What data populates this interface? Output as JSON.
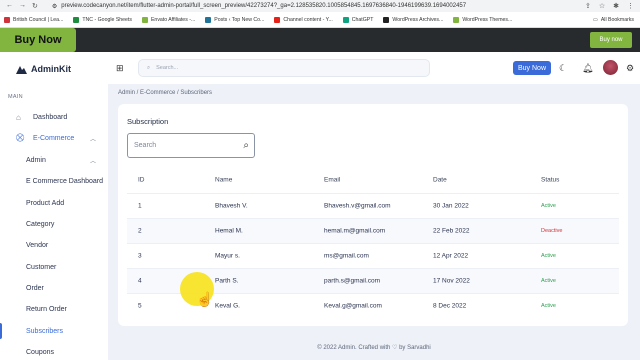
{
  "browser": {
    "url": "preview.codecanyon.net/item/flutter-admin-portal/full_screen_preview/42273274?_ga=2.128535820.1005854845.1697636840-1946199639.1694002457",
    "bookmarks": [
      {
        "label": "British Council | Lea...",
        "color": "#d0333a"
      },
      {
        "label": "TNC - Google Sheets",
        "color": "#1e8e3e"
      },
      {
        "label": "Envato Affiliates -...",
        "color": "#82b440"
      },
      {
        "label": "Posts ‹ Top New Co...",
        "color": "#21759b"
      },
      {
        "label": "Channel content - Y...",
        "color": "#e62117"
      },
      {
        "label": "ChatGPT",
        "color": "#10a37f"
      },
      {
        "label": "WordPress Archives...",
        "color": "#222222"
      },
      {
        "label": "WordPress Themes...",
        "color": "#82b440"
      }
    ],
    "all_bookmarks": "All Bookmarks"
  },
  "promo": {
    "buy_now_left": "Buy Now",
    "buy_now_right": "Buy now"
  },
  "sidebar": {
    "brand": "AdminKit",
    "section": "MAIN",
    "items": [
      {
        "label": "Dashboard"
      },
      {
        "label": "E-Commerce"
      },
      {
        "label": "Admin"
      },
      {
        "label": "E Commerce Dashboard"
      },
      {
        "label": "Product Add"
      },
      {
        "label": "Category"
      },
      {
        "label": "Vendor"
      },
      {
        "label": "Customer"
      },
      {
        "label": "Order"
      },
      {
        "label": "Return Order"
      },
      {
        "label": "Subscribers"
      },
      {
        "label": "Coupons"
      }
    ]
  },
  "header": {
    "search_placeholder": "Search...",
    "buy_now": "Buy Now"
  },
  "breadcrumb": "Admin / E-Commerce  / Subscribers",
  "card": {
    "title": "Subscription",
    "search_placeholder": "Search",
    "columns": [
      "ID",
      "Name",
      "Email",
      "Date",
      "Status"
    ],
    "rows": [
      {
        "id": "1",
        "name": "Bhavesh V.",
        "email": "Bhavesh.v@gmail.com",
        "date": "30 Jan 2022",
        "status": "Active"
      },
      {
        "id": "2",
        "name": "Hemal M.",
        "email": "hemal.m@gmail.com",
        "date": "22 Feb 2022",
        "status": "Deactive"
      },
      {
        "id": "3",
        "name": "Mayur s.",
        "email": "ms@gmail.com",
        "date": "12 Apr 2022",
        "status": "Active"
      },
      {
        "id": "4",
        "name": "Parth S.",
        "email": "parth.s@gmail.com",
        "date": "17 Nov 2022",
        "status": "Active"
      },
      {
        "id": "5",
        "name": "Keval G.",
        "email": "Keval.g@gmail.com",
        "date": "8 Dec 2022",
        "status": "Active"
      }
    ]
  },
  "footer": "© 2022 Admin. Crafted with ♡ by Sarvadhi",
  "colors": {
    "accent": "#3a6bd8",
    "active": "#2e9e4f",
    "deactive": "#d0333a",
    "envato_green": "#82b440"
  }
}
